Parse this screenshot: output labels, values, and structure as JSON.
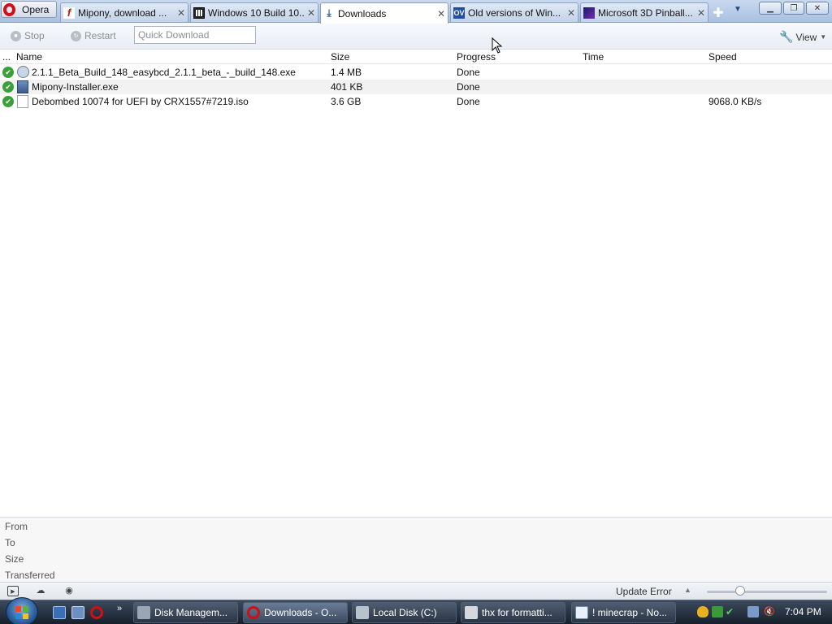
{
  "browser": {
    "menu_label": "Opera"
  },
  "tabs": [
    {
      "label": "Mipony, download ...",
      "icon": "mipony-favicon",
      "active": false
    },
    {
      "label": "Windows 10 Build 10...",
      "icon": "archive-favicon",
      "active": false
    },
    {
      "label": "Downloads",
      "icon": "downloads-favicon",
      "active": true
    },
    {
      "label": "Old versions of Win...",
      "icon": "oldversion-favicon",
      "icon_text": "OV",
      "active": false
    },
    {
      "label": "Microsoft 3D Pinball...",
      "icon": "pinball-favicon",
      "active": false
    }
  ],
  "toolbar": {
    "stop_label": "Stop",
    "restart_label": "Restart",
    "quick_download_placeholder": "Quick Download",
    "view_label": "View"
  },
  "columns": {
    "menu": "...",
    "name": "Name",
    "size": "Size",
    "progress": "Progress",
    "time": "Time",
    "speed": "Speed"
  },
  "downloads": [
    {
      "name": "2.1.1_Beta_Build_148_easybcd_2.1.1_beta_-_build_148.exe",
      "size": "1.4 MB",
      "progress": "Done",
      "time": "",
      "speed": "",
      "icon": "globe-exe-icon"
    },
    {
      "name": "Mipony-Installer.exe",
      "size": "401 KB",
      "progress": "Done",
      "time": "",
      "speed": "",
      "icon": "installer-icon"
    },
    {
      "name": "Debombed 10074 for UEFI by CRX1557#7219.iso",
      "size": "3.6 GB",
      "progress": "Done",
      "time": "",
      "speed": "9068.0 KB/s",
      "icon": "file-icon"
    }
  ],
  "details": {
    "from_label": "From",
    "to_label": "To",
    "size_label": "Size",
    "transferred_label": "Transferred"
  },
  "statusbar": {
    "update_status": "Update Error"
  },
  "taskbar": {
    "buttons": [
      {
        "label": "Disk Managem...",
        "active": false
      },
      {
        "label": "Downloads - O...",
        "active": true
      },
      {
        "label": "Local Disk (C:)",
        "active": false
      },
      {
        "label": "thx for formatti...",
        "active": false
      },
      {
        "label": "! minecrap - No...",
        "active": false
      }
    ],
    "clock": "7:04 PM"
  }
}
